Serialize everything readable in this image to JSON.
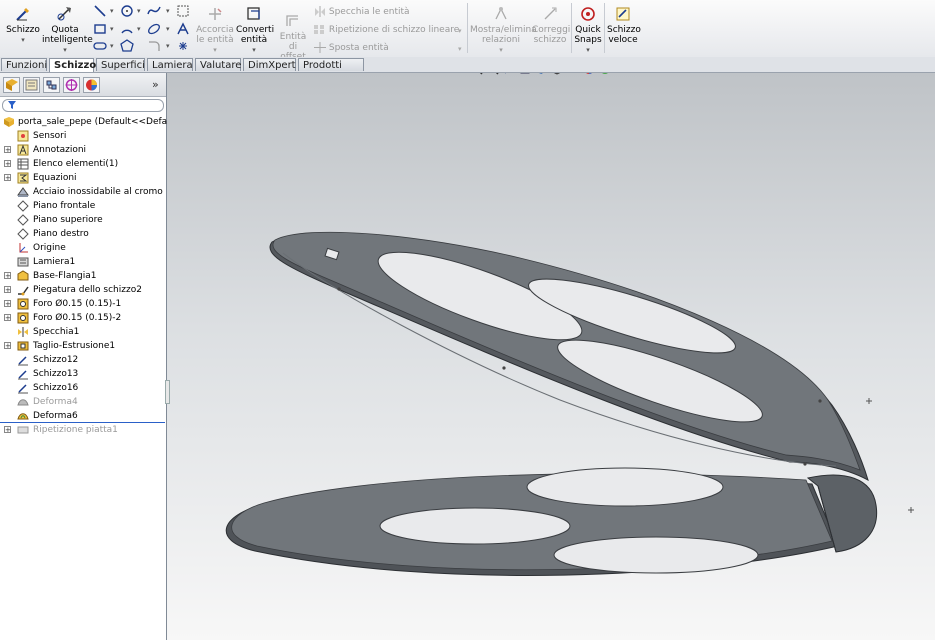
{
  "ribbon": {
    "schizzo": "Schizzo",
    "quota1": "Quota",
    "quota2": "intelligente",
    "accorcia1": "Accorcia",
    "accorcia2": "le entità",
    "converti1": "Converti",
    "converti2": "entità",
    "offset1": "Entità di",
    "offset2": "offset",
    "specchia": "Specchia le entità",
    "ripetizione": "Ripetizione di schizzo lineare",
    "sposta": "Sposta entità",
    "mostra1": "Mostra/elimina",
    "mostra2": "relazioni",
    "correggi1": "Correggi",
    "correggi2": "schizzo",
    "quicksnaps1": "Quick",
    "quicksnaps2": "Snaps",
    "veloce1": "Schizzo",
    "veloce2": "veloce"
  },
  "tabs": [
    "Funzioni",
    "Schizzo",
    "Superfici",
    "Lamiera",
    "Valutare",
    "DimXpert",
    "Prodotti Office"
  ],
  "active_tab": "Schizzo",
  "tree": {
    "root": "porta_sale_pepe  (Default<<Default>_",
    "items": [
      "Sensori",
      "Annotazioni",
      "Elenco elementi(1)",
      "Equazioni",
      "Acciaio inossidabile al cromo",
      "Piano frontale",
      "Piano superiore",
      "Piano destro",
      "Origine",
      "Lamiera1",
      "Base-Flangia1",
      "Piegatura dello schizzo2",
      "Foro Ø0.15 (0.15)-1",
      "Foro Ø0.15 (0.15)-2",
      "Specchia1",
      "Taglio-Estrusione1",
      "Schizzo12",
      "Schizzo13",
      "Schizzo16",
      "Deforma4",
      "Deforma6",
      "Ripetizione piatta1"
    ]
  },
  "colors": {
    "part_top": "#6f7479",
    "part_edge": "#4f5358",
    "hole": "#e9eaec",
    "suppressed": "#9a9a9a"
  }
}
